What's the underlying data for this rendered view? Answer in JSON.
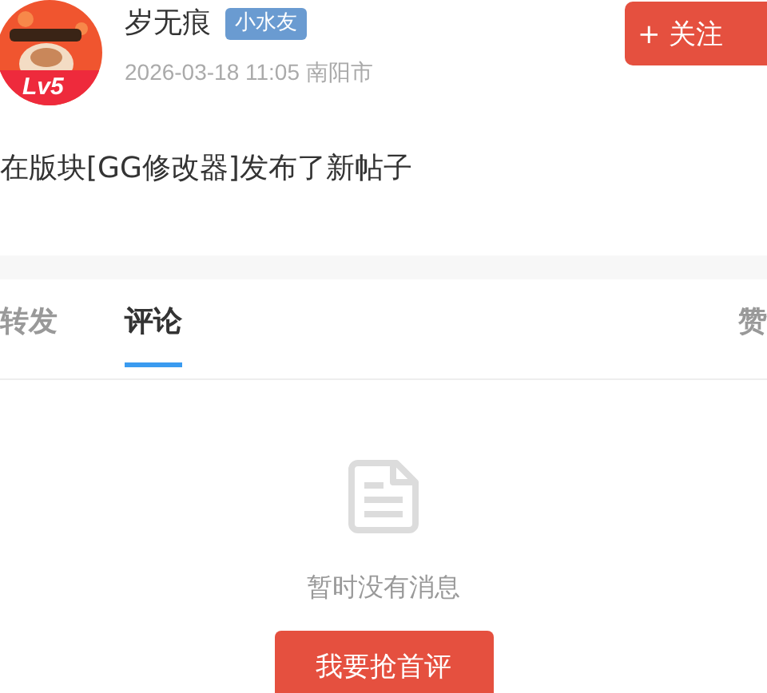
{
  "author": {
    "name": "岁无痕",
    "badge": "小水友",
    "level": "Lv5",
    "time": "2026-03-18 11:05 南阳市",
    "follow": "+ 关注"
  },
  "post": {
    "text": "在版块[GG修改器]发布了新帖子"
  },
  "tabs": [
    {
      "label": "转发",
      "selected": false
    },
    {
      "label": "评论",
      "selected": true
    },
    {
      "label": "赞",
      "selected": false
    }
  ],
  "empty": {
    "message": "暂时没有消息",
    "action": "我要抢首评"
  }
}
